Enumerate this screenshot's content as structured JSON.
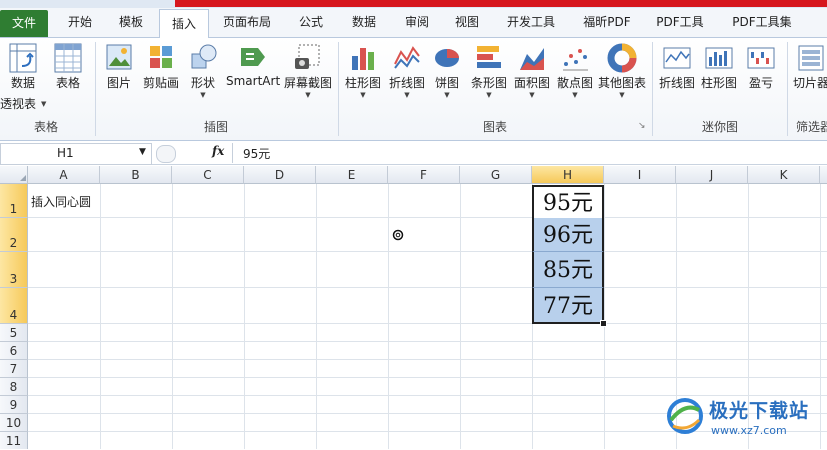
{
  "tabs": [
    "文件",
    "开始",
    "模板",
    "插入",
    "页面布局",
    "公式",
    "数据",
    "审阅",
    "视图",
    "开发工具",
    "福昕PDF",
    "PDF工具",
    "PDF工具集"
  ],
  "active_tab": "插入",
  "ribbon": {
    "table_group": {
      "label": "表格",
      "pivot_line1": "数据",
      "pivot_line2": "透视表",
      "table": "表格"
    },
    "illustrations_group": {
      "label": "插图",
      "picture": "图片",
      "clipart": "剪贴画",
      "shapes": "形状",
      "smartart": "SmartArt",
      "screenshot": "屏幕截图"
    },
    "charts_group": {
      "label": "图表",
      "column": "柱形图",
      "line": "折线图",
      "pie": "饼图",
      "bar": "条形图",
      "area": "面积图",
      "scatter": "散点图",
      "other": "其他图表"
    },
    "sparklines_group": {
      "label": "迷你图",
      "line": "折线图",
      "column": "柱形图",
      "winloss": "盈亏"
    },
    "filter_group": {
      "label": "筛选器",
      "slicer": "切片器"
    }
  },
  "formula_bar": {
    "name_box": "H1",
    "fx_label": "fx",
    "content": "95元"
  },
  "columns": [
    "A",
    "B",
    "C",
    "D",
    "E",
    "F",
    "G",
    "H",
    "I",
    "J",
    "K"
  ],
  "selected_column": "H",
  "rows": [
    "1",
    "2",
    "3",
    "4",
    "5",
    "6",
    "7",
    "8",
    "9",
    "10",
    "11"
  ],
  "cells": {
    "A1": "插入同心圆",
    "H1": "95元",
    "H2": "96元",
    "H3": "85元",
    "H4": "77元"
  },
  "watermark": {
    "name": "极光下载站",
    "url": "www.xz7.com"
  }
}
